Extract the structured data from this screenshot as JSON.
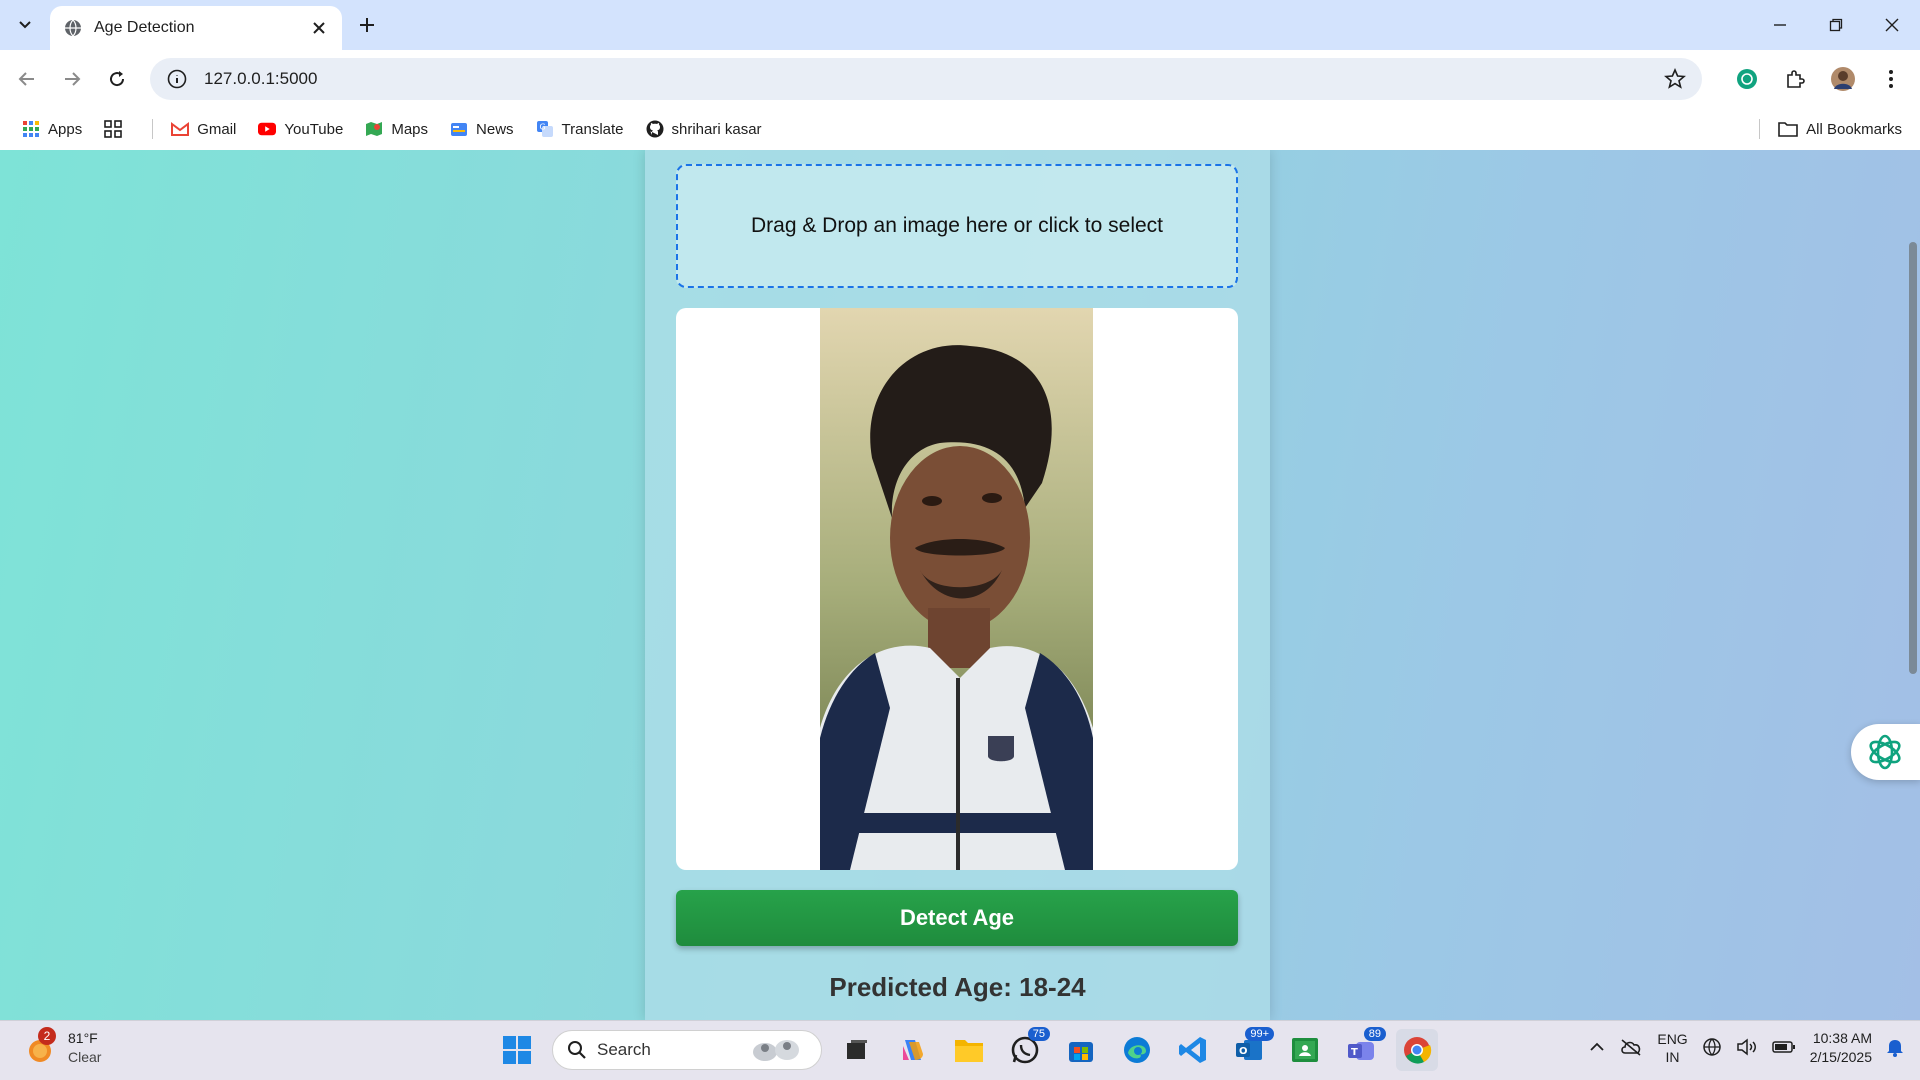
{
  "browser": {
    "tab_title": "Age Detection",
    "url": "127.0.0.1:5000",
    "bookmarks": [
      "Apps",
      "Gmail",
      "YouTube",
      "Maps",
      "News",
      "Translate",
      "shrihari kasar"
    ],
    "all_bookmarks": "All Bookmarks"
  },
  "page": {
    "dropzone_text": "Drag & Drop an image here or click to select",
    "detect_button": "Detect Age",
    "predicted_label": "Predicted Age: 18-24",
    "button_color": "#28a745",
    "accent_border": "#1a73e8"
  },
  "taskbar": {
    "weather_temp": "81°F",
    "weather_desc": "Clear",
    "weather_badge": "2",
    "search_label": "Search",
    "whatsapp_count": "75",
    "outlook_count": "99+",
    "teams_count": "89",
    "lang_1": "ENG",
    "lang_2": "IN",
    "time": "10:38 AM",
    "date": "2/15/2025"
  }
}
